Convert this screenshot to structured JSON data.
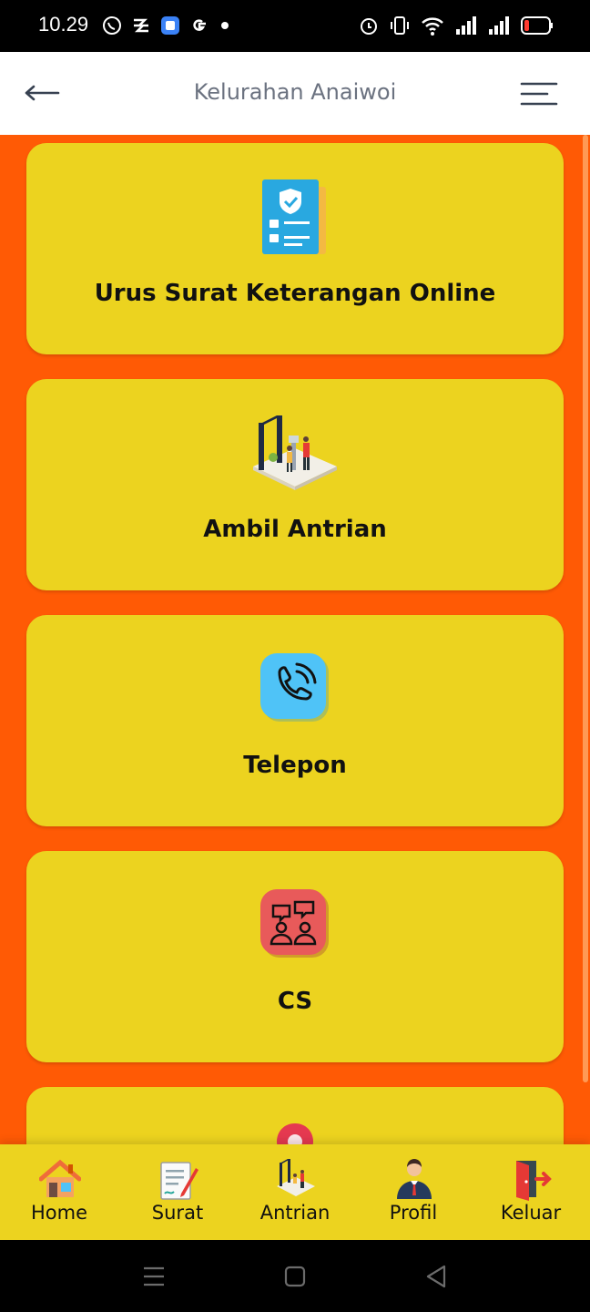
{
  "status_bar": {
    "time": "10.29",
    "left_icons": [
      "whatsapp-icon",
      "app-icon",
      "app-icon",
      "google-icon",
      "dot-icon"
    ],
    "right_icons": [
      "alarm-icon",
      "vibrate-icon",
      "wifi-icon",
      "signal-icon",
      "signal-icon",
      "battery-icon"
    ],
    "battery_accent": "#ff3b30"
  },
  "header": {
    "title": "Kelurahan Anaiwoi"
  },
  "menu_cards": [
    {
      "label": "Urus Surat Keterangan Online",
      "icon": "document-checklist-icon"
    },
    {
      "label": "Ambil Antrian",
      "icon": "queue-kiosk-icon"
    },
    {
      "label": "Telepon",
      "icon": "phone-icon"
    },
    {
      "label": "CS",
      "icon": "customer-service-icon"
    },
    {
      "label": "",
      "icon": "location-pin-icon"
    }
  ],
  "bottom_nav": [
    {
      "label": "Home",
      "icon": "home-icon"
    },
    {
      "label": "Surat",
      "icon": "letter-edit-icon"
    },
    {
      "label": "Antrian",
      "icon": "queue-icon"
    },
    {
      "label": "Profil",
      "icon": "profile-icon"
    },
    {
      "label": "Keluar",
      "icon": "exit-door-icon"
    }
  ],
  "colors": {
    "background": "#ff5a05",
    "card": "#ecd31f",
    "header": "#ffffff",
    "title_text": "#6b7280",
    "phone_tile": "#4fc3f7",
    "cs_tile": "#e85a5a"
  }
}
